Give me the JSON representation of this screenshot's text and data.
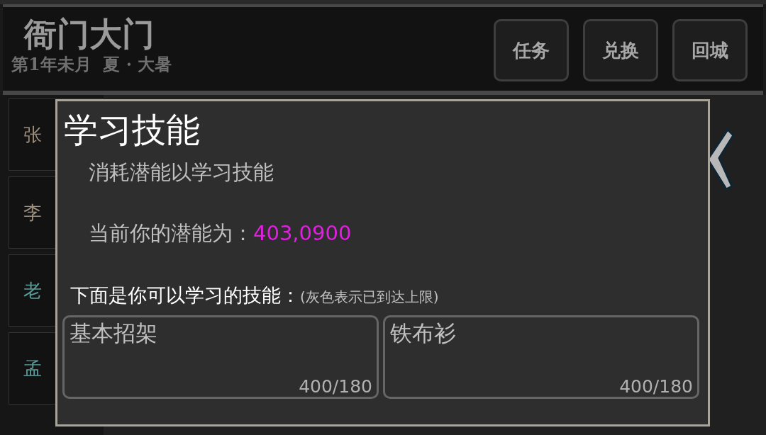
{
  "header": {
    "title": "衙门大门",
    "date": "第1年未月  夏 · 大暑",
    "buttons": [
      "任务",
      "兑换",
      "回城"
    ]
  },
  "npc_list": [
    {
      "name": "张",
      "color": "#a08f7c"
    },
    {
      "name": "李",
      "color": "#a08f7c"
    },
    {
      "name": "老",
      "color": "#5a9e9a"
    },
    {
      "name": "孟",
      "color": "#5a9e9a"
    }
  ],
  "dialog": {
    "title": "学习技能",
    "subtitle": "消耗潜能以学习技能",
    "potential_label": "当前你的潜能为：",
    "potential_value": "403,0900",
    "list_heading": "下面是你可以学习的技能：",
    "list_note": "(灰色表示已到达上限)",
    "skills": [
      {
        "name": "基本招架",
        "progress": "400/180"
      },
      {
        "name": "铁布衫",
        "progress": "400/180"
      }
    ]
  }
}
